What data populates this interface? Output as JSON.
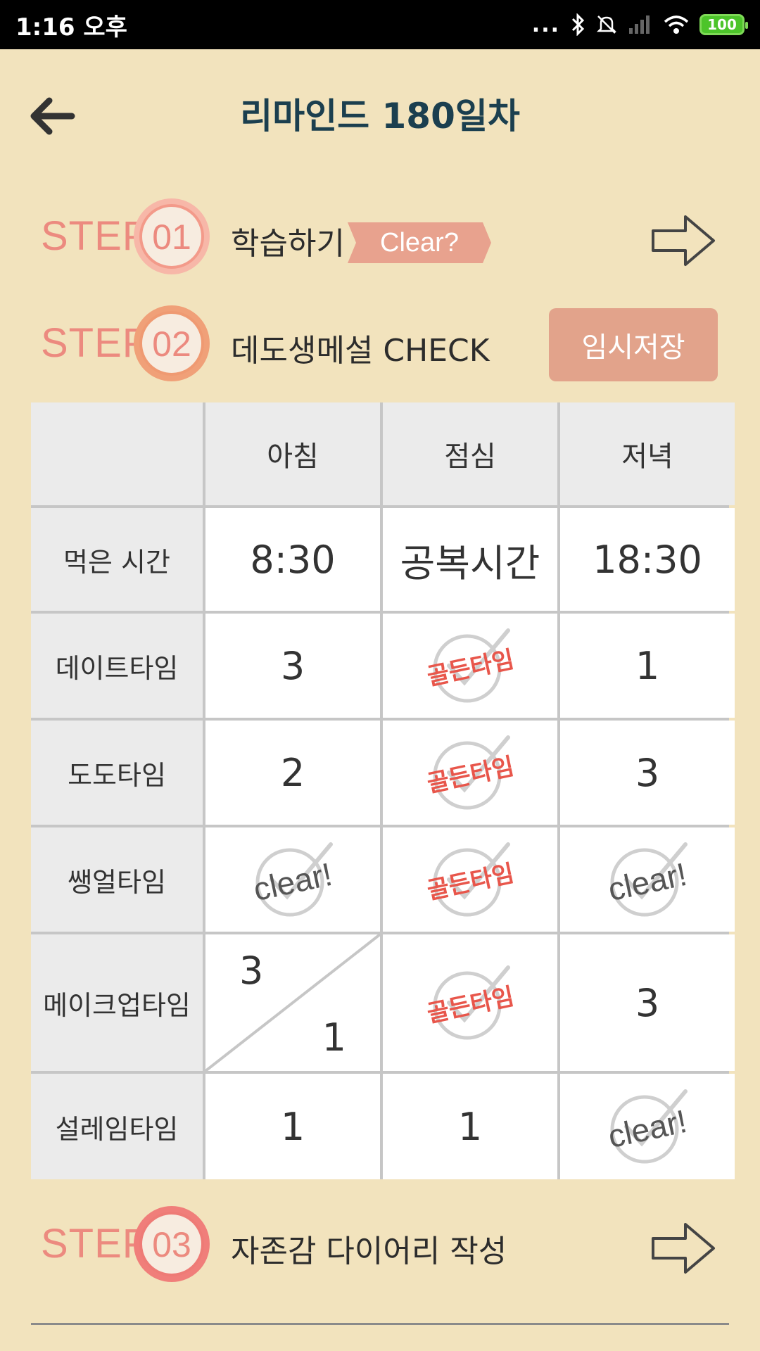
{
  "status_bar": {
    "time": "1:16 오후",
    "dots": "...",
    "battery": "100"
  },
  "header": {
    "title": "리마인드 180일차"
  },
  "steps": [
    {
      "label": "STEP",
      "number": "01",
      "text": "학습하기",
      "tag": "Clear?"
    },
    {
      "label": "STEP",
      "number": "02",
      "text": "데도생메설 CHECK",
      "button": "임시저장"
    },
    {
      "label": "STEP",
      "number": "03",
      "text": "자존감 다이어리 작성"
    }
  ],
  "table": {
    "columns": [
      "아침",
      "점심",
      "저녁"
    ],
    "rows": [
      {
        "label": "먹은 시간",
        "cells": [
          "8:30",
          "공복시간",
          "18:30"
        ]
      },
      {
        "label": "데이트타임",
        "cells": [
          "3",
          "골든타임",
          "1"
        ]
      },
      {
        "label": "도도타임",
        "cells": [
          "2",
          "골든타임",
          "3"
        ]
      },
      {
        "label": "쌩얼타임",
        "cells": [
          "clear!",
          "골든타임",
          "clear!"
        ]
      },
      {
        "label": "메이크업타임",
        "cells": [
          [
            "3",
            "1"
          ],
          "골든타임",
          "3"
        ]
      },
      {
        "label": "설레임타임",
        "cells": [
          "1",
          "1",
          "clear!"
        ]
      }
    ]
  },
  "colors": {
    "background": "#f2e3bd",
    "step_accent": "#ec8a7f",
    "button": "#e2a38b",
    "title": "#1b3f4f",
    "golden_stamp": "#e8564b"
  }
}
